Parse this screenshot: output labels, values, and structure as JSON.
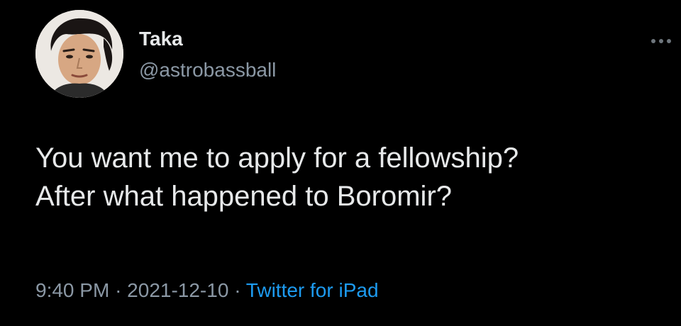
{
  "user": {
    "display_name": "Taka",
    "handle": "@astrobassball",
    "avatar_icon": "profile-photo"
  },
  "tweet": {
    "lines": [
      "You want me to apply for a fellowship?",
      "After what happened to Boromir?"
    ]
  },
  "meta": {
    "time": "9:40 PM",
    "separator": "·",
    "date": "2021-12-10",
    "source": "Twitter for iPad"
  },
  "menu": {
    "icon": "more-horizontal-icon"
  },
  "colors": {
    "background": "#000000",
    "text_primary": "#e7e9ea",
    "text_secondary": "#8b98a5",
    "link_accent": "#1d9bf0"
  }
}
